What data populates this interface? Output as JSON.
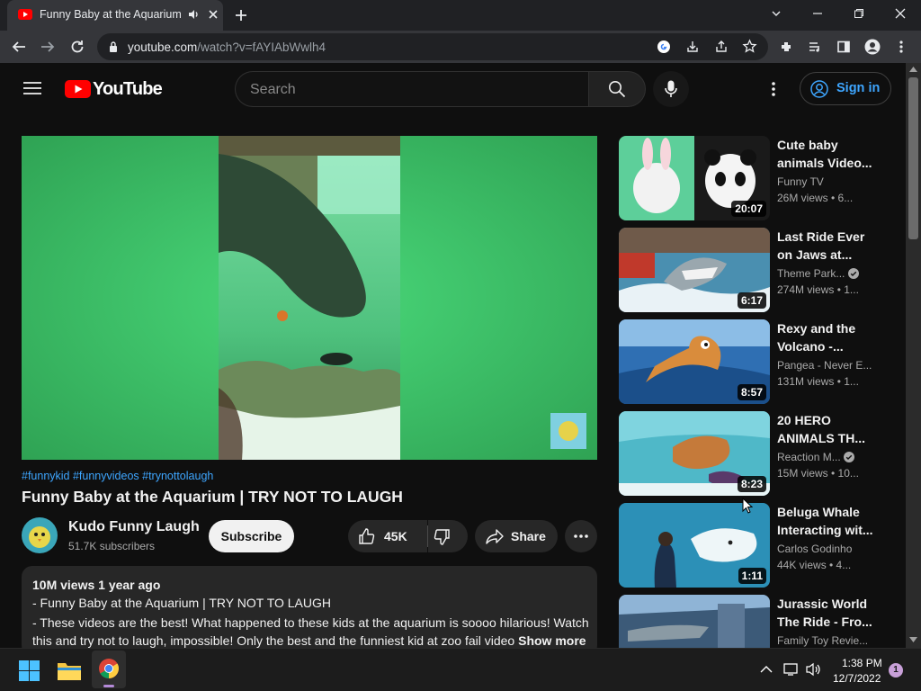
{
  "browser": {
    "tab_title": "Funny Baby at the Aquarium",
    "url_host": "youtube.com",
    "url_path": "/watch?v=fAYIAbWwlh4"
  },
  "header": {
    "logo_text": "YouTube",
    "search_placeholder": "Search",
    "signin_label": "Sign in"
  },
  "video": {
    "hashtags": "#funnykid #funnyvideos #trynottolaugh",
    "title": "Funny Baby at the Aquarium | TRY NOT TO LAUGH",
    "channel": "Kudo Funny Laugh",
    "subscribers": "51.7K subscribers",
    "subscribe_label": "Subscribe",
    "likes": "45K",
    "share_label": "Share",
    "description": {
      "meta": "10M views  1 year ago",
      "line1": "- Funny Baby at the Aquarium | TRY NOT TO LAUGH",
      "line2": "- These videos are the best! What happened to these kids at the aquarium is soooo hilarious! Watch this and try not to laugh, impossible! Only the best and the funniest kid at zoo fail video",
      "show_more": "Show more"
    }
  },
  "recommendations": [
    {
      "title1": "Cute baby",
      "title2": "animals Video...",
      "channel": "Funny TV",
      "views": "26M views  • 6...",
      "duration": "20:07",
      "verified": false
    },
    {
      "title1": "Last Ride Ever",
      "title2": "on Jaws at...",
      "channel": "Theme Park...",
      "views": "274M views  • 1...",
      "duration": "6:17",
      "verified": true
    },
    {
      "title1": "Rexy and the",
      "title2": "Volcano -...",
      "channel": "Pangea - Never E...",
      "views": "131M views  • 1...",
      "duration": "8:57",
      "verified": false
    },
    {
      "title1": "20 HERO",
      "title2": "ANIMALS TH...",
      "channel": "Reaction M...",
      "views": "15M views  • 10...",
      "duration": "8:23",
      "verified": true
    },
    {
      "title1": "Beluga Whale",
      "title2": "Interacting wit...",
      "channel": "Carlos Godinho",
      "views": "44K views  • 4...",
      "duration": "1:11",
      "verified": false
    },
    {
      "title1": "Jurassic World",
      "title2": "The Ride - Fro...",
      "channel": "Family Toy Revie...",
      "views": "",
      "duration": "",
      "verified": false
    }
  ],
  "taskbar": {
    "time": "1:38 PM",
    "date": "12/7/2022",
    "notification_count": "1"
  }
}
